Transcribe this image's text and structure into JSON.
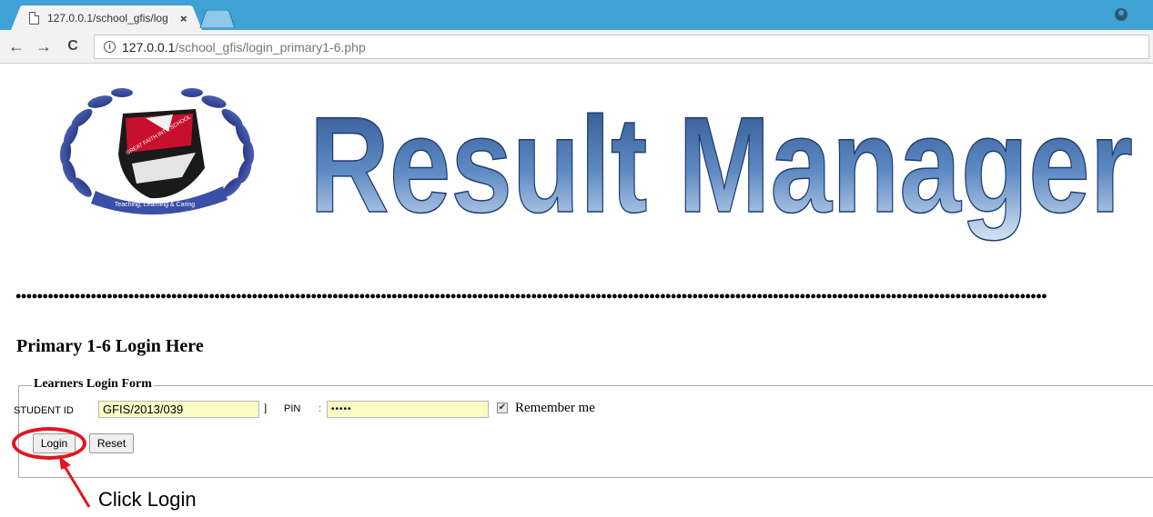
{
  "browser": {
    "tab_title": "127.0.0.1/school_gfis/log",
    "tab_close": "×",
    "back": "←",
    "forward": "→",
    "reload": "C",
    "url_host": "127.0.0.1",
    "url_path": "/school_gfis/login_primary1-6.php"
  },
  "page": {
    "banner_text": "Result Manager",
    "logo_text": "GREAT FAITH INT'L SCHOOL",
    "logo_motto": "Teaching, Learning & Caring",
    "separator": "••••••••••••••••••••••••••••••••••••••••••••••••••••••••••••••••••••••••••••••••••••••••••••••••••••••••••••••••••••••••••••••••••••••••••••••••••••••••••••••••••••••••••••••••••••••••••••••••",
    "heading": "Primary 1-6 Login Here"
  },
  "form": {
    "legend": "Learners Login Form",
    "student_id_label": "STUDENT ID",
    "student_id_value": "GFIS/2013/039",
    "bracket": "]",
    "pin_label": "PIN",
    "pin_colon": ":",
    "pin_value": "•••••",
    "remember_checked": true,
    "remember_mark": "✔",
    "remember_label": "Remember me",
    "login_label": "Login",
    "reset_label": "Reset"
  },
  "annotation": {
    "text": "Click Login",
    "color": "#e0161e"
  },
  "colors": {
    "tabbar": "#3fa1d4",
    "input_bg": "#fbfbc4",
    "banner_blue_dark": "#2a4f8a",
    "banner_blue_light": "#d5e3f3"
  }
}
